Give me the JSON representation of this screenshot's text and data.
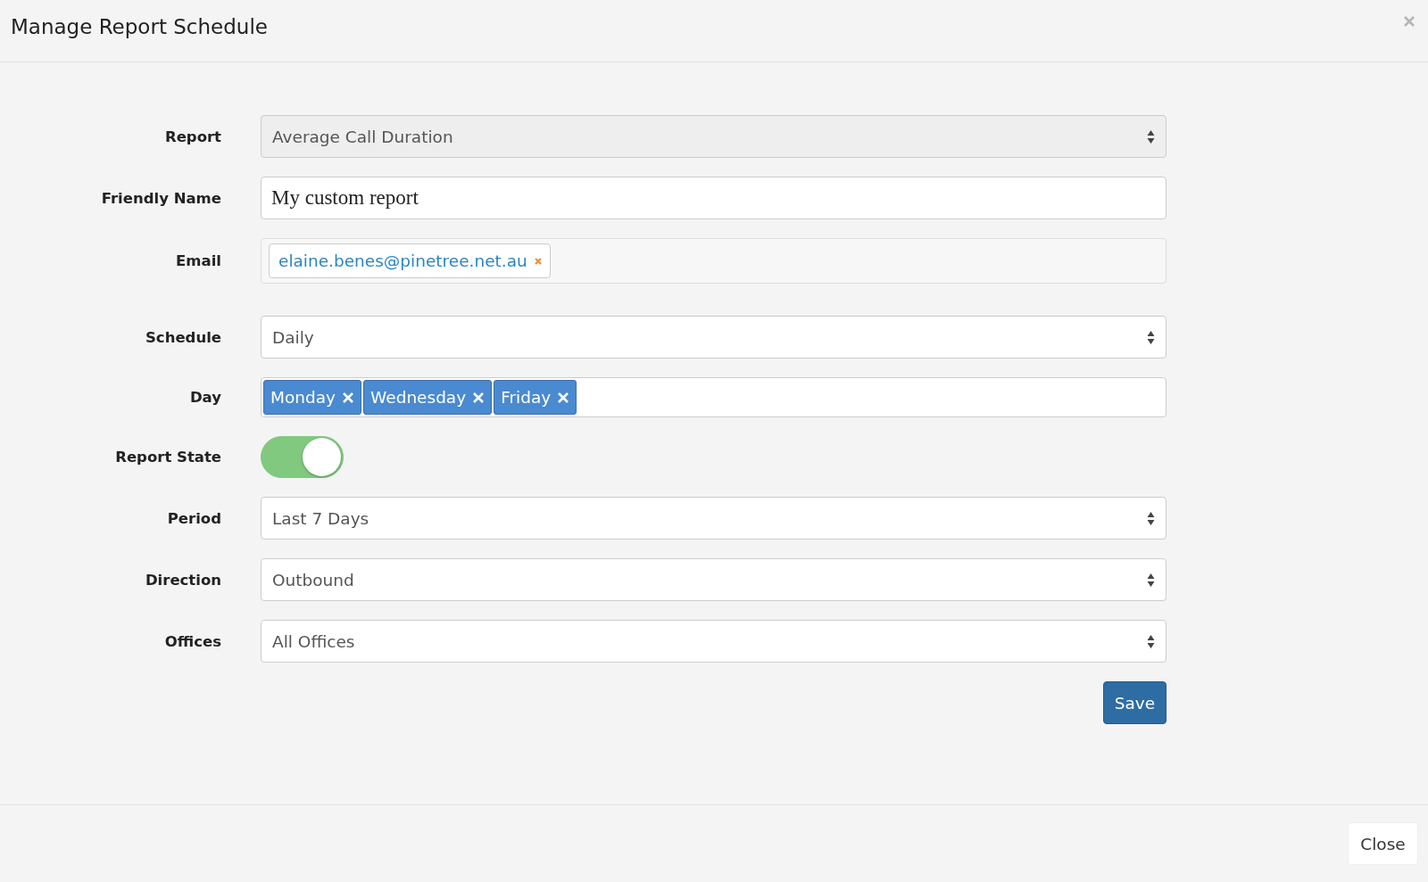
{
  "dialog": {
    "title": "Manage Report Schedule"
  },
  "fields": [
    {
      "kind": "select",
      "label": "Report",
      "value": "Average Call Duration",
      "disabled": true
    },
    {
      "kind": "text",
      "label": "Friendly Name",
      "value": "My custom report"
    },
    {
      "kind": "email-tags",
      "label": "Email",
      "tags": [
        "elaine.benes@pinetree.net.au"
      ]
    },
    {
      "kind": "select",
      "label": "Schedule",
      "value": "Daily",
      "disabled": false
    },
    {
      "kind": "day-tags",
      "label": "Day",
      "tags": [
        "Monday",
        "Wednesday",
        "Friday"
      ]
    },
    {
      "kind": "toggle",
      "label": "Report State",
      "on": true
    },
    {
      "kind": "select",
      "label": "Period",
      "value": "Last 7 Days",
      "disabled": false
    },
    {
      "kind": "select",
      "label": "Direction",
      "value": "Outbound",
      "disabled": false
    },
    {
      "kind": "select",
      "label": "Offices",
      "value": "All Offices",
      "disabled": false
    }
  ],
  "save_button": "Save",
  "close_button": "Close"
}
